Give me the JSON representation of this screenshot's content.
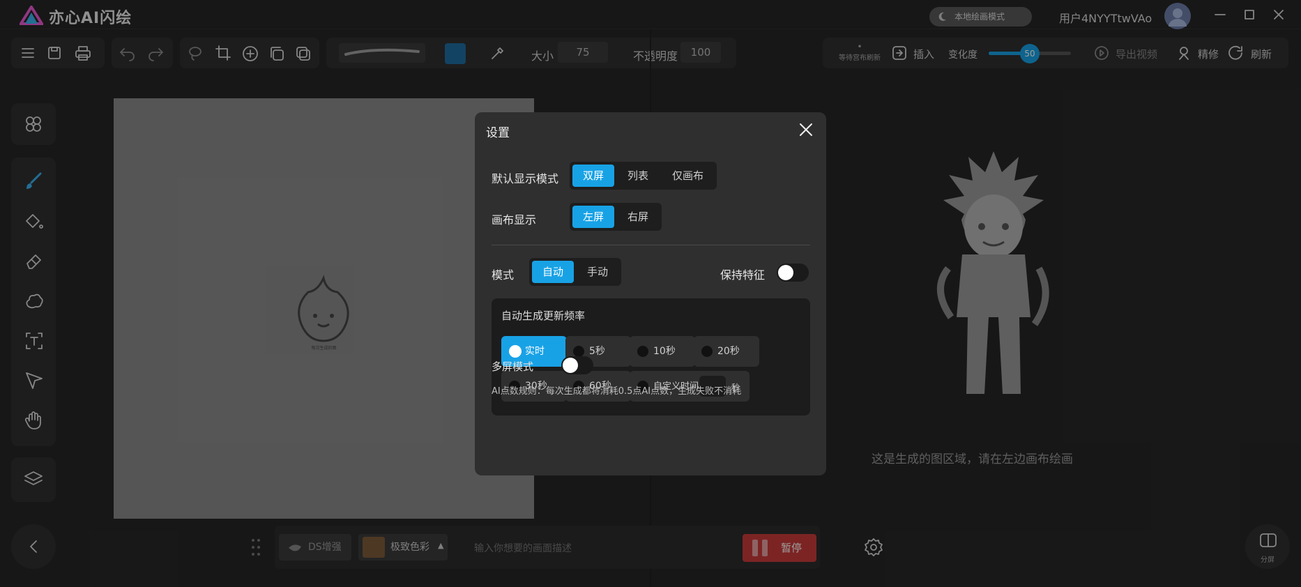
{
  "app": {
    "title": "亦心AI闪绘",
    "mode_pill": "本地绘画模式",
    "user_name": "用户4NYYTtwVAo"
  },
  "toolbar": {
    "size_label": "大小",
    "size_value": "75",
    "opacity_label": "不透明度",
    "opacity_value": "100",
    "color": "#1f6d9e"
  },
  "right_toolbar": {
    "wait_label": "等待宫布刷新",
    "insert": "插入",
    "variation_label": "变化度",
    "variation_value": 50,
    "export": "导出视频",
    "refine": "精修",
    "refresh": "刷新"
  },
  "right_panel": {
    "hint": "这是生成的图区域，请在左边画布绘画"
  },
  "canvas": {
    "watermark": "每次生成的图"
  },
  "settings": {
    "title": "设置",
    "display_mode_label": "默认显示模式",
    "display_modes": [
      "双屏",
      "列表",
      "仅画布"
    ],
    "canvas_display_label": "画布显示",
    "canvas_displays": [
      "左屏",
      "右屏"
    ],
    "mode_label": "模式",
    "modes": [
      "自动",
      "手动"
    ],
    "keep_feature_label": "保持特征",
    "freq_title": "自动生成更新频率",
    "freq_options": [
      "实时",
      "5秒",
      "10秒",
      "20秒",
      "30秒",
      "60秒"
    ],
    "custom_time_label": "自定义时间",
    "custom_unit": "秒",
    "multi_screen_label": "多屏模式",
    "points_rule": "AI点数规则：每次生成都将消耗0.5点AI点数，生成失败不消耗"
  },
  "bottom": {
    "ds_enhance": "DS增强",
    "style_name": "极致色彩",
    "prompt_placeholder": "输入你想要的画面描述",
    "pause": "暂停",
    "split": "分屏"
  }
}
